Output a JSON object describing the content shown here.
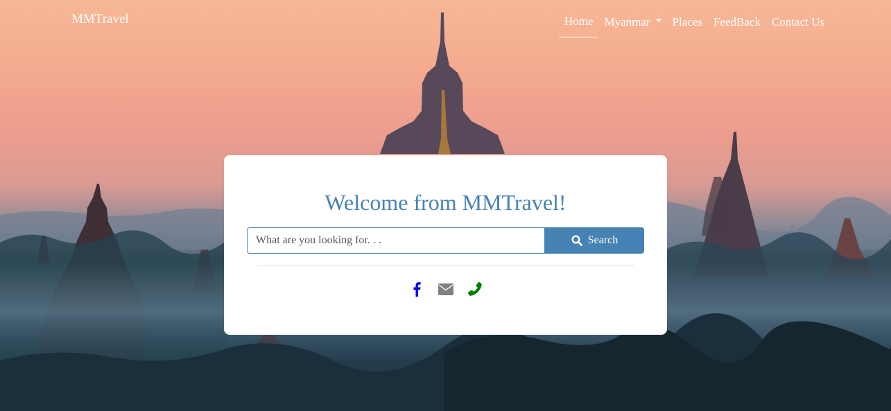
{
  "navbar": {
    "brand": "MMTravel",
    "links": [
      {
        "label": "Home",
        "active": true
      },
      {
        "label": "Myanmar",
        "dropdown": true
      },
      {
        "label": "Places"
      },
      {
        "label": "FeedBack"
      },
      {
        "label": "Contact Us"
      }
    ]
  },
  "hero": {
    "title": "Welcome from MMTravel!",
    "search": {
      "placeholder": "What are you looking for. . .",
      "value": "",
      "button_label": "Search",
      "button_icon": "search-icon"
    },
    "social": [
      {
        "name": "facebook-icon",
        "color": "#0000ff"
      },
      {
        "name": "envelope-icon",
        "color": "#808080"
      },
      {
        "name": "phone-icon",
        "color": "#008000"
      }
    ]
  },
  "colors": {
    "accent": "#4682b4"
  }
}
